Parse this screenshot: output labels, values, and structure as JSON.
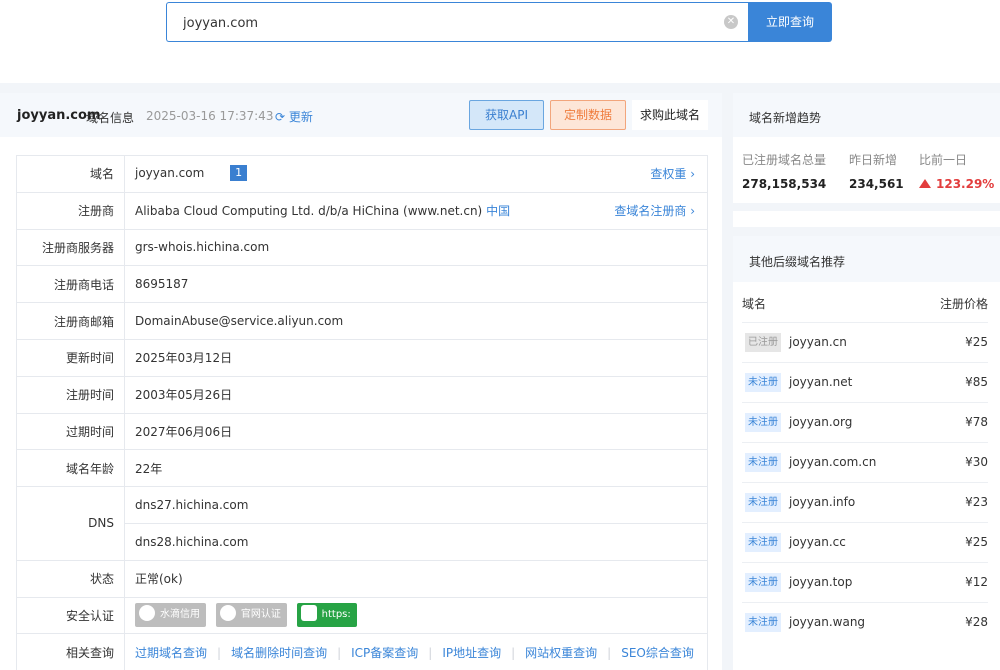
{
  "search": {
    "value": "joyyan.com",
    "button": "立即查询"
  },
  "header": {
    "domain": "joyyan.com",
    "suffix": "域名信息",
    "time": "2025-03-16 17:37:43",
    "refresh": "更新",
    "api_btn": "获取API",
    "custom_btn": "定制数据",
    "buy_btn": "求购此域名"
  },
  "info": {
    "domain_label": "域名",
    "domain_value": "joyyan.com",
    "domain_badge": "1",
    "domain_link": "查权重",
    "registrar_label": "注册商",
    "registrar_value": "Alibaba Cloud Computing Ltd. d/b/a HiChina (www.net.cn)",
    "registrar_country": "中国",
    "registrar_link": "查域名注册商",
    "server_label": "注册商服务器",
    "server_value": "grs-whois.hichina.com",
    "phone_label": "注册商电话",
    "phone_value": "8695187",
    "email_label": "注册商邮箱",
    "email_value": "DomainAbuse@service.aliyun.com",
    "updated_label": "更新时间",
    "updated_value": "2025年03月12日",
    "created_label": "注册时间",
    "created_value": "2003年05月26日",
    "expires_label": "过期时间",
    "expires_value": "2027年06月06日",
    "age_label": "域名年龄",
    "age_value": "22年",
    "dns_label": "DNS",
    "dns1": "dns27.hichina.com",
    "dns2": "dns28.hichina.com",
    "status_label": "状态",
    "status_value": "正常(ok)",
    "security_label": "安全认证",
    "sec1": "水滴信用",
    "sec2": "官网认证",
    "sec3": "https:",
    "related_label": "相关查询",
    "related": [
      "过期域名查询",
      "域名删除时间查询",
      "ICP备案查询",
      "IP地址查询",
      "网站权重查询",
      "SEO综合查询"
    ]
  },
  "trend": {
    "title": "域名新增趋势",
    "total_label": "已注册域名总量",
    "total_value": "278,158,534",
    "yesterday_label": "昨日新增",
    "yesterday_value": "234,561",
    "change_label": "比前一日",
    "change_value": "123.29%"
  },
  "recommend": {
    "title": "其他后缀域名推荐",
    "col_name": "域名",
    "col_price": "注册价格",
    "rows": [
      {
        "tag": "已注册",
        "name": "joyyan.cn",
        "price": "¥25"
      },
      {
        "tag": "未注册",
        "name": "joyyan.net",
        "price": "¥85"
      },
      {
        "tag": "未注册",
        "name": "joyyan.org",
        "price": "¥78"
      },
      {
        "tag": "未注册",
        "name": "joyyan.com.cn",
        "price": "¥30"
      },
      {
        "tag": "未注册",
        "name": "joyyan.info",
        "price": "¥23"
      },
      {
        "tag": "未注册",
        "name": "joyyan.cc",
        "price": "¥25"
      },
      {
        "tag": "未注册",
        "name": "joyyan.top",
        "price": "¥12"
      },
      {
        "tag": "未注册",
        "name": "joyyan.wang",
        "price": "¥28"
      }
    ]
  }
}
